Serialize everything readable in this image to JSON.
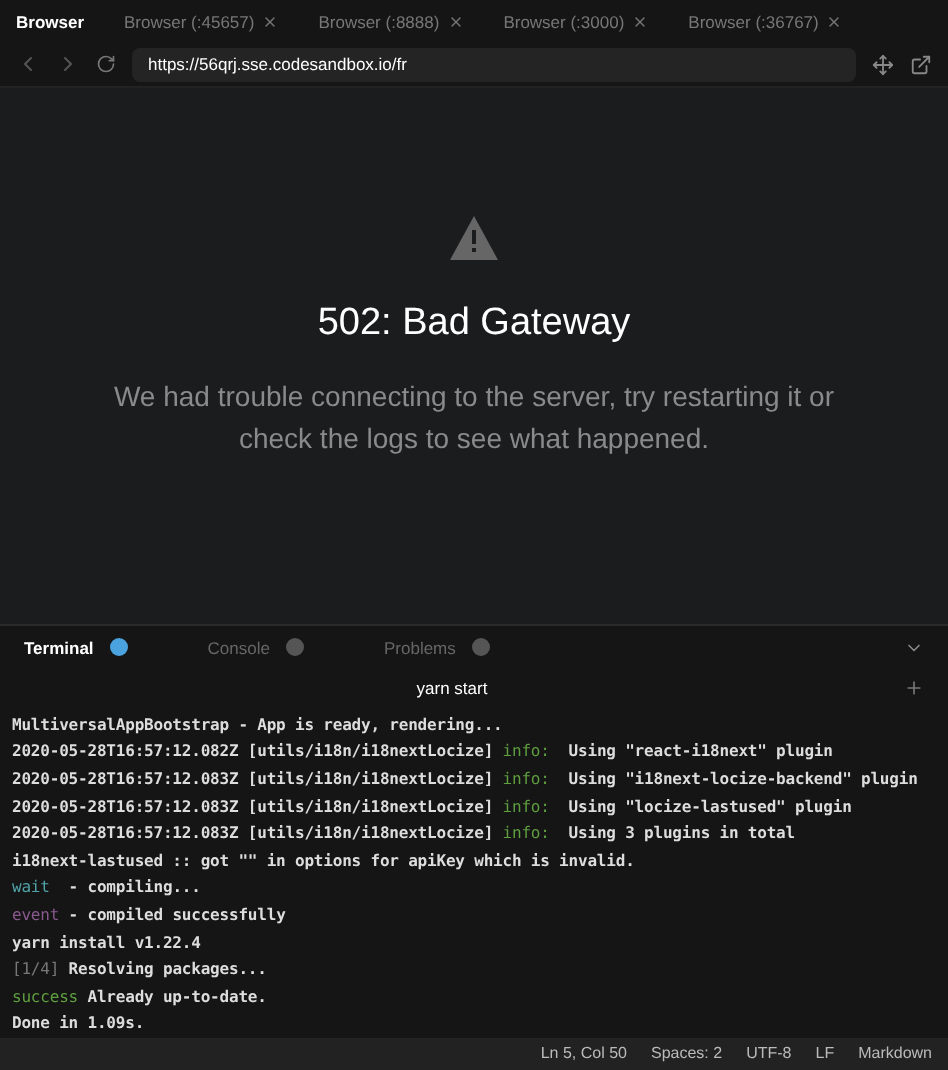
{
  "browser_tabs": [
    {
      "label": "Browser",
      "selected": true,
      "closable": false
    },
    {
      "label": "Browser (:45657)",
      "selected": false,
      "closable": true
    },
    {
      "label": "Browser (:8888)",
      "selected": false,
      "closable": true
    },
    {
      "label": "Browser (:3000)",
      "selected": false,
      "closable": true
    },
    {
      "label": "Browser (:36767)",
      "selected": false,
      "closable": true
    }
  ],
  "url": "https://56qrj.sse.codesandbox.io/fr",
  "error": {
    "title": "502: Bad Gateway",
    "message": "We had trouble connecting to the server, try restarting it or check the logs to see what happened."
  },
  "panel_tabs": [
    {
      "label": "Terminal",
      "selected": true
    },
    {
      "label": "Console",
      "selected": false
    },
    {
      "label": "Problems",
      "selected": false
    }
  ],
  "terminal_title": "yarn start",
  "lines": [
    {
      "text": "MultiversalAppBootstrap - App is ready, rendering..."
    },
    {
      "before": "2020-05-28T16:57:12.082Z [utils/i18n/i18nextLocize] ",
      "tag": "info:",
      "color": "#5f9f3f",
      "text": "  Using \"react-i18next\" plugin"
    },
    {
      "before": "2020-05-28T16:57:12.083Z [utils/i18n/i18nextLocize] ",
      "tag": "info:",
      "color": "#5f9f3f",
      "text": "  Using \"i18next-locize-backend\" plugin"
    },
    {
      "before": "2020-05-28T16:57:12.083Z [utils/i18n/i18nextLocize] ",
      "tag": "info:",
      "color": "#5f9f3f",
      "text": "  Using \"locize-lastused\" plugin"
    },
    {
      "before": "2020-05-28T16:57:12.083Z [utils/i18n/i18nextLocize] ",
      "tag": "info:",
      "color": "#5f9f3f",
      "text": "  Using 3 plugins in total"
    },
    {
      "text": "i18next-lastused :: got \"\" in options for apiKey which is invalid."
    },
    {
      "tag": "wait",
      "color": "#4fa3a8",
      "text": "  - compiling..."
    },
    {
      "tag": "event",
      "color": "#8a5a8f",
      "text": " - compiled successfully"
    },
    {
      "text": "yarn install v1.22.4"
    },
    {
      "tag": "[1/4]",
      "color": "#777777",
      "text": " Resolving packages..."
    },
    {
      "tag": "success",
      "color": "#5f9f3f",
      "text": " Already up-to-date."
    },
    {
      "text": "Done in 1.09s."
    }
  ],
  "status_bar": [
    "Ln 5, Col 50",
    "Spaces: 2",
    "UTF-8",
    "LF",
    "Markdown"
  ]
}
